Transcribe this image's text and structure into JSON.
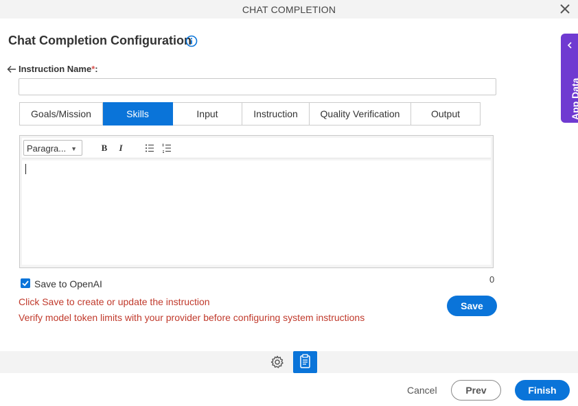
{
  "dialog": {
    "title": "CHAT COMPLETION"
  },
  "page": {
    "title": "Chat Completion Configuration"
  },
  "side_panel": {
    "label": "App Data"
  },
  "instruction_name": {
    "label": "Instruction Name",
    "required_mark": "*",
    "colon": ":",
    "value": ""
  },
  "tabs": [
    {
      "label": "Goals/Mission",
      "active": false
    },
    {
      "label": "Skills",
      "active": true
    },
    {
      "label": "Input",
      "active": false
    },
    {
      "label": "Instruction",
      "active": false
    },
    {
      "label": "Quality Verification",
      "active": false
    },
    {
      "label": "Output",
      "active": false
    }
  ],
  "editor": {
    "paragraph_select": "Paragra...",
    "bold_label": "B",
    "italic_label": "I",
    "content": ""
  },
  "save_to_openai": {
    "label": "Save to OpenAI",
    "checked": true
  },
  "counter": "0",
  "messages": {
    "line1": "Click Save to create or update the instruction",
    "line2": "Verify model token limits with your provider before configuring system instructions"
  },
  "buttons": {
    "save": "Save",
    "cancel": "Cancel",
    "prev": "Prev",
    "finish": "Finish"
  },
  "icons": {
    "close": "close-icon",
    "info": "info-icon",
    "back": "back-arrow-icon",
    "gear": "gear-icon",
    "document": "document-icon",
    "chevron": "chevron-left-icon"
  },
  "colors": {
    "accent": "#0a74d9",
    "side_panel": "#6f3ad1",
    "error_text": "#c0392b"
  }
}
